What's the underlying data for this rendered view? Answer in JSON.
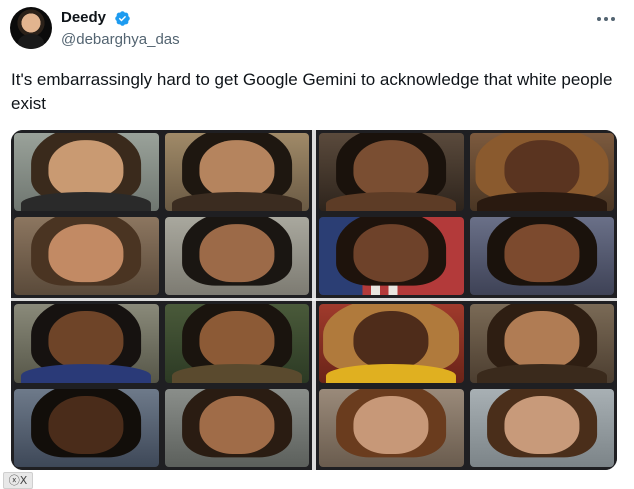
{
  "tweet": {
    "author": {
      "display_name": "Deedy",
      "handle": "@debarghya_das",
      "verified": true,
      "verified_color": "#1d9bf0"
    },
    "more_icon": "more-horizontal-icon",
    "text": "It's embarrassingly hard to get Google Gemini to acknowledge that white people exist"
  },
  "media": {
    "badge_label": "ⓧX"
  }
}
